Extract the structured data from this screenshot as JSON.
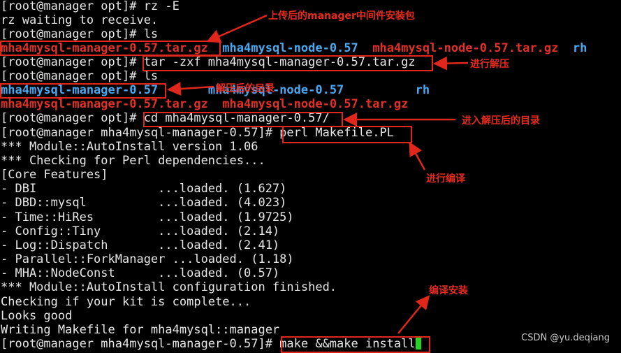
{
  "terminal": {
    "lines": [
      "[root@manager opt]# rz -E",
      "rz waiting to receive.",
      "[root@manager opt]# ls",
      "",
      "[root@manager opt]# tar -zxf mha4mysql-manager-0.57.tar.gz",
      "[root@manager opt]# ls",
      "",
      "",
      "[root@manager opt]# cd mha4mysql-manager-0.57/",
      "[root@manager mha4mysql-manager-0.57]# perl Makefile.PL",
      "*** Module::AutoInstall version 1.06",
      "*** Checking for Perl dependencies...",
      "[Core Features]",
      "- DBI                 ...loaded. (1.627)",
      "- DBD::mysql          ...loaded. (4.023)",
      "- Time::HiRes         ...loaded. (1.9725)",
      "- Config::Tiny        ...loaded. (2.14)",
      "- Log::Dispatch       ...loaded. (2.41)",
      "- Parallel::ForkManager ...loaded. (1.18)",
      "- MHA::NodeConst      ...loaded. (0.57)",
      "*** Module::AutoInstall configuration finished.",
      "Checking if your kit is complete...",
      "Looks good",
      "Writing Makefile for mha4mysql::manager",
      "[root@manager mha4mysql-manager-0.57]# make &&make install"
    ],
    "ls1": {
      "manager_tar": "mha4mysql-manager-0.57.tar.gz",
      "node_dir": "mha4mysql-node-0.57",
      "node_tar": "mha4mysql-node-0.57.tar.gz",
      "rh": "rh"
    },
    "ls2": {
      "manager_dir": "mha4mysql-manager-0.57",
      "node_dir": "mha4mysql-node-0.57",
      "rh": "rh",
      "manager_tar": "mha4mysql-manager-0.57.tar.gz",
      "node_tar": "mha4mysql-node-0.57.tar.gz"
    }
  },
  "annotations": {
    "uploaded": "上传后的manager中间件安装包",
    "extract": "进行解压",
    "extracted_dir": "解压后的目录",
    "enter_dir": "进入解压后的目录",
    "compile": "进行编译",
    "install": "编译安装"
  },
  "watermark": "CSDN @yu.deqiang",
  "colors": {
    "background": "#000000",
    "text": "#e6e6e6",
    "archive": "#e0302a",
    "directory": "#4aa8f0",
    "annotation": "#e62a1f",
    "cursor": "#22d622"
  }
}
